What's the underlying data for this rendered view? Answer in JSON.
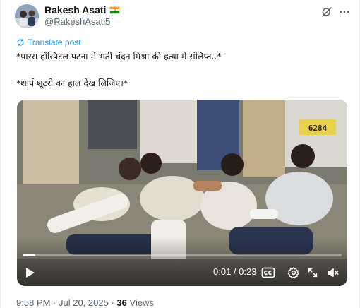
{
  "author": {
    "display_name": "Rakesh Asati",
    "handle": "@RakeshAsati5",
    "flag_icon": "india-flag-icon",
    "flag_colors": [
      "#ff9933",
      "#ffffff",
      "#138808"
    ]
  },
  "header_actions": {
    "grok_icon": "grok-icon",
    "more_icon": "more-horizontal-icon"
  },
  "translate": {
    "icon": "translate-icon",
    "label": "Translate post"
  },
  "tweet": {
    "line1": "*पारस हॉस्पिटल पटना में भर्ती चंदन मिश्रा की हत्या मे संलिप्त..*",
    "line2": "*शार्प शूटरो का हाल देख लिजिए।*"
  },
  "video": {
    "progress": 0.04,
    "current_time": "0:01",
    "duration": "0:23",
    "timecode": "0:01 / 0:23",
    "play_icon": "play-icon",
    "captions_icon": "captions-icon",
    "settings_icon": "gear-icon",
    "expand_icon": "expand-icon",
    "mute_icon": "volume-mute-icon",
    "plate_text": "6284"
  },
  "meta": {
    "time": "9:58 PM",
    "separator": "·",
    "date": "Jul 20, 2025",
    "views_count": "36",
    "views_label": "Views"
  },
  "colors": {
    "text_primary": "#0f1419",
    "text_secondary": "#536471",
    "link": "#1d9bf0"
  }
}
